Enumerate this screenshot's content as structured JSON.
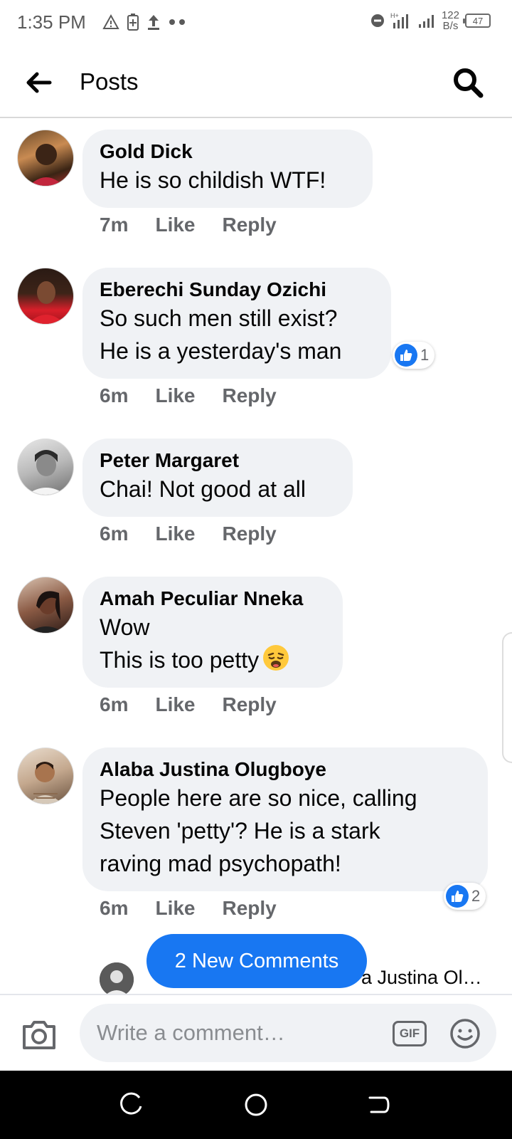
{
  "status_bar": {
    "time": "1:35 PM",
    "net_speed_value": "122",
    "net_speed_unit": "B/s",
    "battery": "47",
    "icons": [
      "alert-triangle-icon",
      "battery-saver-icon",
      "upload-icon",
      "more-dots-icon",
      "do-not-disturb-icon",
      "signal-icon",
      "signal-icon"
    ]
  },
  "header": {
    "title": "Posts",
    "back_icon": "arrow-left-icon",
    "search_icon": "search-icon"
  },
  "comments": [
    {
      "author": "Gold Dick",
      "lines": [
        "He is so childish WTF!"
      ],
      "time": "7m",
      "like": "Like",
      "reply": "Reply",
      "reactions": null
    },
    {
      "author": "Eberechi Sunday Ozichi",
      "lines": [
        "So such men still exist?",
        "He is a yesterday's man"
      ],
      "time": "6m",
      "like": "Like",
      "reply": "Reply",
      "reactions": "1"
    },
    {
      "author": "Peter Margaret",
      "lines": [
        "Chai! Not good at all"
      ],
      "time": "6m",
      "like": "Like",
      "reply": "Reply",
      "reactions": null
    },
    {
      "author": "Amah Peculiar Nneka",
      "lines": [
        "Wow",
        "This is too petty"
      ],
      "time": "6m",
      "like": "Like",
      "reply": "Reply",
      "reactions": null,
      "emoji": "tired-face-emoji"
    },
    {
      "author": "Alaba Justina Olugboye",
      "lines": [
        "People here are so nice, calling",
        "Steven 'petty'? He is a stark",
        "raving mad psychopath!"
      ],
      "time": "6m",
      "like": "Like",
      "reply": "Reply",
      "reactions": "2"
    }
  ],
  "new_comments_button": "2 New Comments",
  "reply_preview": "a Justina Ol…",
  "composer": {
    "placeholder": "Write a comment…",
    "gif_label": "GIF",
    "camera_icon": "camera-icon",
    "emoji_icon": "smiley-icon"
  },
  "nav_bar": [
    "recents-icon",
    "home-icon",
    "back-icon"
  ],
  "colors": {
    "accent": "#1877f2",
    "bubble": "#f0f2f5",
    "meta": "#65676b"
  }
}
